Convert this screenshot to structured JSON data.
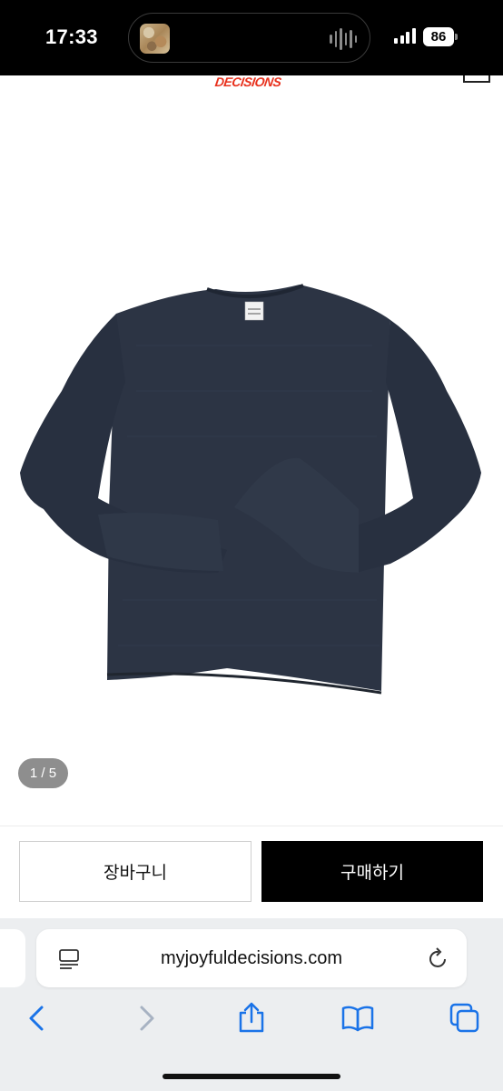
{
  "status_bar": {
    "time": "17:33",
    "battery_level": "86",
    "icons": [
      "now-playing-artwork-icon",
      "audio-waveform-icon",
      "cellular-signal-icon",
      "battery-icon"
    ]
  },
  "site": {
    "brand_logo": "DECISIONS",
    "menu_icon": "menu-icon"
  },
  "product": {
    "image_description_icon": "product-photo",
    "image_counter": "1 / 5"
  },
  "actions": {
    "cart_label": "장바구니",
    "buy_label": "구매하기"
  },
  "browser": {
    "url": "myjoyfuldecisions.com",
    "icons": [
      "page-menu-icon",
      "reload-icon",
      "back-icon",
      "forward-icon",
      "share-icon",
      "bookmarks-icon",
      "tabs-icon"
    ]
  },
  "colors": {
    "accent_logo": "#e8321e",
    "sweater": "#2c3444",
    "toolbar_bg": "#eceef0",
    "link_blue": "#1a73e8"
  }
}
